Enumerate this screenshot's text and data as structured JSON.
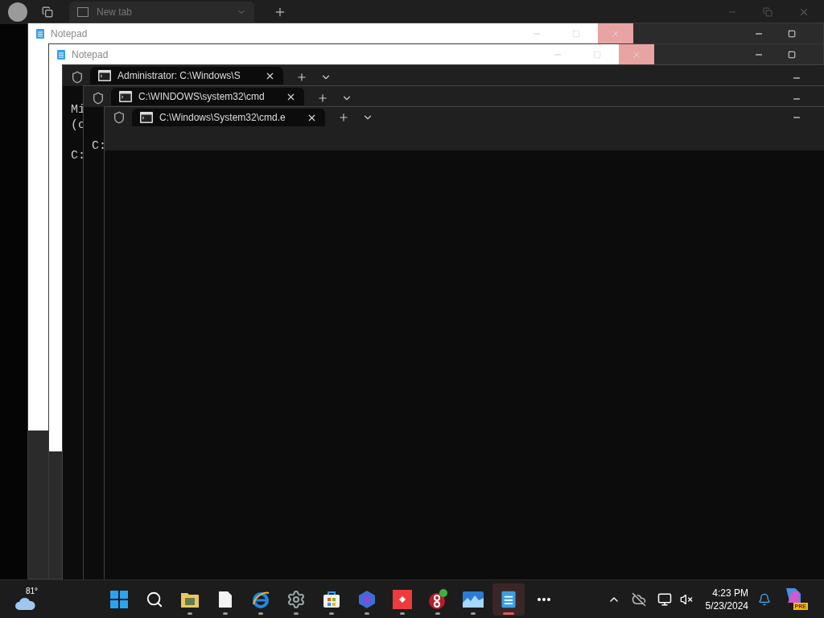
{
  "browser": {
    "tab_title": "New tab"
  },
  "notepads": [
    {
      "title": "Notepad"
    },
    {
      "title": "Notepad"
    }
  ],
  "terminals": [
    {
      "tab_title": "Administrator: C:\\Windows\\S",
      "lines": [
        {
          "text": "Mi",
          "gap_before": false
        },
        {
          "text": "(c",
          "gap_before": false
        },
        {
          "text": "C:",
          "gap_before": true
        }
      ]
    },
    {
      "tab_title": "C:\\WINDOWS\\system32\\cmd",
      "lines": [
        {
          "text": "C:",
          "gap_before": true
        }
      ]
    },
    {
      "tab_title": "C:\\Windows\\System32\\cmd.e"
    }
  ],
  "taskbar": {
    "weather": {
      "temperature": "81°"
    },
    "apps": [
      {
        "kind": "start",
        "running": false,
        "selected": false
      },
      {
        "kind": "search",
        "running": false,
        "selected": false
      },
      {
        "kind": "folder",
        "running": true,
        "selected": false
      },
      {
        "kind": "file",
        "running": true,
        "selected": false
      },
      {
        "kind": "browser",
        "running": true,
        "selected": false
      },
      {
        "kind": "settings",
        "running": true,
        "selected": false
      },
      {
        "kind": "store",
        "running": true,
        "selected": false
      },
      {
        "kind": "copilot",
        "running": true,
        "selected": false
      },
      {
        "kind": "remote",
        "running": true,
        "selected": false
      },
      {
        "kind": "eight",
        "running": true,
        "selected": false
      },
      {
        "kind": "photos",
        "running": true,
        "selected": false
      },
      {
        "kind": "notepad",
        "running": true,
        "selected": true
      },
      {
        "kind": "more",
        "running": false,
        "selected": false
      }
    ],
    "clock": {
      "time": "4:23 PM",
      "date": "5/23/2024"
    },
    "copilot_badge": "PRE"
  }
}
